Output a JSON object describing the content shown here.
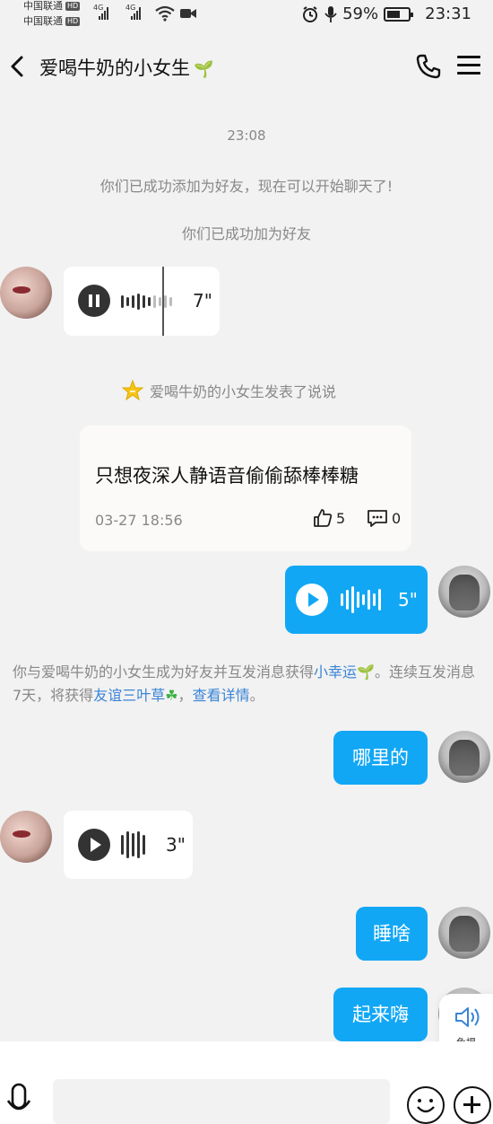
{
  "status_bar": {
    "carrier_1": "中国联通",
    "carrier_2": "中国联通",
    "hd_badge": "HD",
    "network": "4G",
    "battery": "59%",
    "time": "23:31"
  },
  "header": {
    "title": "爱喝牛奶的小女生",
    "title_icon": "sprout-icon"
  },
  "chat": {
    "timestamp": "23:08",
    "notice_added_full": "你们已成功添加为好友，现在可以开始聊天了!",
    "notice_added_short": "你们已成功加为好友",
    "voice_1_duration": "7\"",
    "post_notice": "爱喝牛奶的小女生发表了说说",
    "post": {
      "text": "只想夜深人静语音偷偷舔棒棒糖",
      "time": "03-27 18:56",
      "likes": "5",
      "comments": "0"
    },
    "voice_2_duration": "5\"",
    "system": {
      "part1": "你与爱喝牛奶的小女生成为好友并互发消息获得",
      "link1": "小幸运",
      "part2": "。连续互发消息7天，将获得",
      "link2": "友谊三叶草",
      "part3": "，",
      "link3": "查看详情",
      "part4": "。"
    },
    "msg_1": "哪里的",
    "voice_3_duration": "3\"",
    "msg_2": "睡啥",
    "msg_3": "起来嗨",
    "speaker_label": "免提"
  },
  "input": {
    "placeholder": ""
  },
  "colors": {
    "accent_blue": "#12a7f5",
    "link_blue": "#3a84d6",
    "background": "#f2f2f2"
  }
}
